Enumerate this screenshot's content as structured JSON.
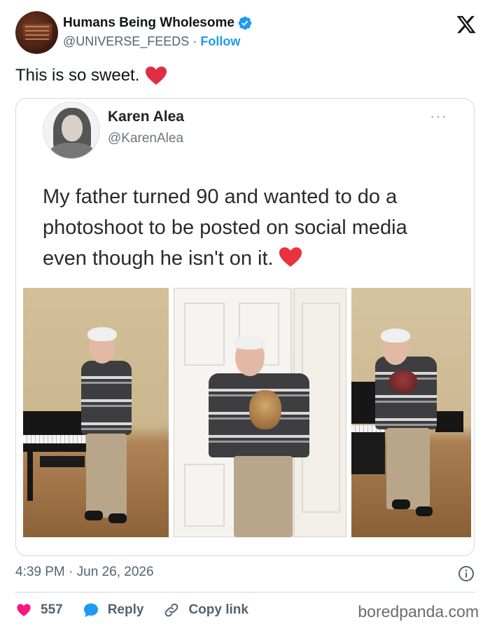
{
  "account": {
    "name": "Humans Being Wholesome",
    "handle": "@UNIVERSE_FEEDS",
    "separator": " · ",
    "follow_label": "Follow"
  },
  "icons": {
    "verified": "verified-badge-icon",
    "logo": "x-logo-icon",
    "heart": "heart-emoji-icon",
    "info": "info-icon",
    "like": "heart-icon",
    "reply": "reply-bubble-icon",
    "link": "link-icon"
  },
  "colors": {
    "accent": "#1d9bf0",
    "heart": "#f91880",
    "muted": "#536471"
  },
  "tweet": {
    "text": "This is so sweet."
  },
  "embedded": {
    "name": "Karen Alea",
    "handle": "@KarenAlea",
    "more": "···",
    "text": "My father turned 90 and wanted to do a photoshoot to be posted on social media even though he isn't on it.",
    "photos": [
      "photo-piano",
      "photo-door-with-dog",
      "photo-hugging-dog"
    ]
  },
  "meta": {
    "time": "4:39 PM",
    "separator": " · ",
    "date": "Jun 26, 2026"
  },
  "actions": {
    "likes": "557",
    "reply_label": "Reply",
    "copy_label": "Copy link"
  },
  "watermark": "boredpanda.com"
}
